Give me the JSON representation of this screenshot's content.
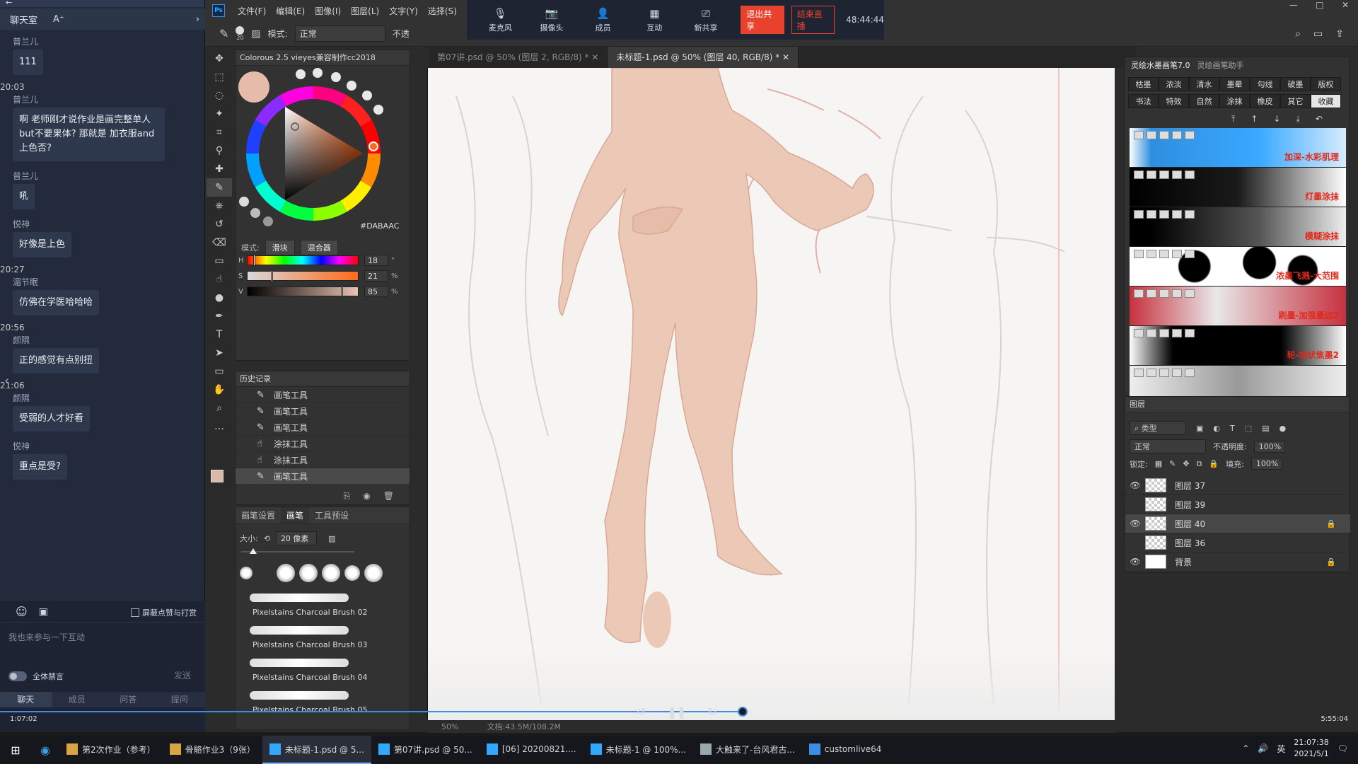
{
  "chat": {
    "title": "聊天室",
    "font_btn": "A⁺",
    "messages": [
      {
        "user": "普兰儿",
        "text": "111"
      },
      {
        "time": "20:03"
      },
      {
        "user": "普兰儿",
        "text": "啊 老师刚才说作业是画完整单人but不要果体? 那就是 加衣服and上色否?"
      },
      {
        "user": "普兰儿",
        "text": "吼"
      },
      {
        "user": "悦神",
        "text": "好像是上色"
      },
      {
        "time": "20:27"
      },
      {
        "user": "湄节眠",
        "text": "仿佛在学医哈哈哈"
      },
      {
        "time": "20:56"
      },
      {
        "user": "颜隰",
        "text": "正的感觉有点别扭"
      },
      {
        "time": "21:06"
      },
      {
        "user": "颜隰",
        "text": "受弱的人才好看"
      },
      {
        "user": "悦神",
        "text": "重点是受?"
      }
    ],
    "block_label": "屏蔽点赞与打赏",
    "input_placeholder": "我也来参与一下互动",
    "mute_label": "全体禁言",
    "send_label": "发送",
    "tabs": [
      "聊天",
      "成员",
      "问答",
      "提问"
    ],
    "elapsed": "1:07:02",
    "duration": "5:55:04"
  },
  "ps": {
    "menu": [
      "文件(F)",
      "编辑(E)",
      "图像(I)",
      "图层(L)",
      "文字(Y)",
      "选择(S)"
    ],
    "mode_label": "模式:",
    "mode_value": "正常",
    "opacity_label": "不透",
    "brush_size_small": "20",
    "meeting": {
      "buttons": [
        {
          "label": "麦克风",
          "icon": "mic-icon"
        },
        {
          "label": "摄像头",
          "icon": "camera-icon"
        },
        {
          "label": "成员",
          "icon": "person-icon"
        },
        {
          "label": "互动",
          "icon": "grid-icon"
        },
        {
          "label": "新共享",
          "icon": "share-icon"
        }
      ],
      "stop_share": "退出共享",
      "end_live": "结束直播",
      "timer": "48:44:44"
    },
    "color_panel": {
      "title": "Colorous 2.5 vieyes兼容制作cc2018",
      "hex": "#DABAAC",
      "mode_label": "模式:",
      "mode_a": "滑块",
      "mode_b": "混合器",
      "h": "18",
      "s": "21",
      "v": "85",
      "pct": "%",
      "selected_color": "#dabaac",
      "h_frac": 0.05,
      "s_frac": 0.21,
      "v_frac": 0.85
    },
    "history": {
      "title": "历史记录",
      "items": [
        "画笔工具",
        "画笔工具",
        "画笔工具",
        "涂抹工具",
        "涂抹工具",
        "画笔工具"
      ]
    },
    "brush_panel": {
      "tabs": [
        "画笔设置",
        "画笔",
        "工具预设"
      ],
      "size_label": "大小:",
      "size_value": "20 像素",
      "brushes": [
        "Pixelstains Charcoal Brush 02",
        "Pixelstains Charcoal Brush 03",
        "Pixelstains Charcoal Brush 04",
        "Pixelstains Charcoal Brush 05"
      ]
    },
    "doc_tabs": [
      {
        "label": "第07讲.psd @ 50% (图层 2, RGB/8) *",
        "active": false
      },
      {
        "label": "未标题-1.psd @ 50% (图层 40, RGB/8) *",
        "active": true
      }
    ],
    "status": {
      "zoom": "50%",
      "doc": "文档:43.5M/108.2M"
    },
    "brush_lib": {
      "tabs": [
        "灵绘水墨画笔7.0",
        "灵绘画笔助手"
      ],
      "categories": [
        "枯墨",
        "浓淡",
        "清水",
        "墨晕",
        "勾线",
        "破墨",
        "版权",
        "书法",
        "特效",
        "自然",
        "涂抹",
        "橡皮",
        "其它",
        "收藏"
      ],
      "selected_category": "收藏",
      "presets": [
        {
          "label": "加深-水彩肌理",
          "style": "blue"
        },
        {
          "label": "灯墨涂抹",
          "style": "dark1"
        },
        {
          "label": "模糊涂抹",
          "style": "dark2"
        },
        {
          "label": "浓墨飞溅-大范围",
          "style": "splash"
        },
        {
          "label": "刷墨-加强墨边2",
          "style": "red"
        },
        {
          "label": "轮-块状焦墨2",
          "style": "black"
        },
        {
          "label": "",
          "style": "grey"
        }
      ]
    },
    "layers": {
      "title": "图层",
      "filter_label": "类型",
      "blend_mode": "正常",
      "opacity_label": "不透明度:",
      "opacity_value": "100%",
      "lock_label": "锁定:",
      "fill_label": "填充:",
      "fill_value": "100%",
      "items": [
        {
          "name": "图层 37",
          "visible": true,
          "selected": false,
          "locked": false,
          "white": false
        },
        {
          "name": "图层 39",
          "visible": false,
          "selected": false,
          "locked": false,
          "white": false
        },
        {
          "name": "图层 40",
          "visible": true,
          "selected": true,
          "locked": true,
          "white": false
        },
        {
          "name": "图层 36",
          "visible": false,
          "selected": false,
          "locked": false,
          "white": false
        },
        {
          "name": "背景",
          "visible": true,
          "selected": false,
          "locked": true,
          "white": true
        }
      ]
    }
  },
  "taskbar": {
    "tasks": [
      {
        "label": "第2次作业（参考）",
        "active": false,
        "color": "#d9a441"
      },
      {
        "label": "骨骼作业3（9张）",
        "active": false,
        "color": "#d9a441"
      },
      {
        "label": "未标题-1.psd @ 5...",
        "active": true,
        "color": "#31a8ff"
      },
      {
        "label": "第07讲.psd @ 50...",
        "active": false,
        "color": "#31a8ff"
      },
      {
        "label": "[06] 20200821....",
        "active": false,
        "color": "#31a8ff"
      },
      {
        "label": "未标题-1 @ 100%...",
        "active": false,
        "color": "#31a8ff"
      },
      {
        "label": "大触来了-台风君古...",
        "active": false,
        "color": "#9aa"
      },
      {
        "label": "customlive64",
        "active": false,
        "color": "#3a8ee6"
      }
    ],
    "time": "21:07:38",
    "date": "2021/5/1",
    "ime": "英"
  }
}
